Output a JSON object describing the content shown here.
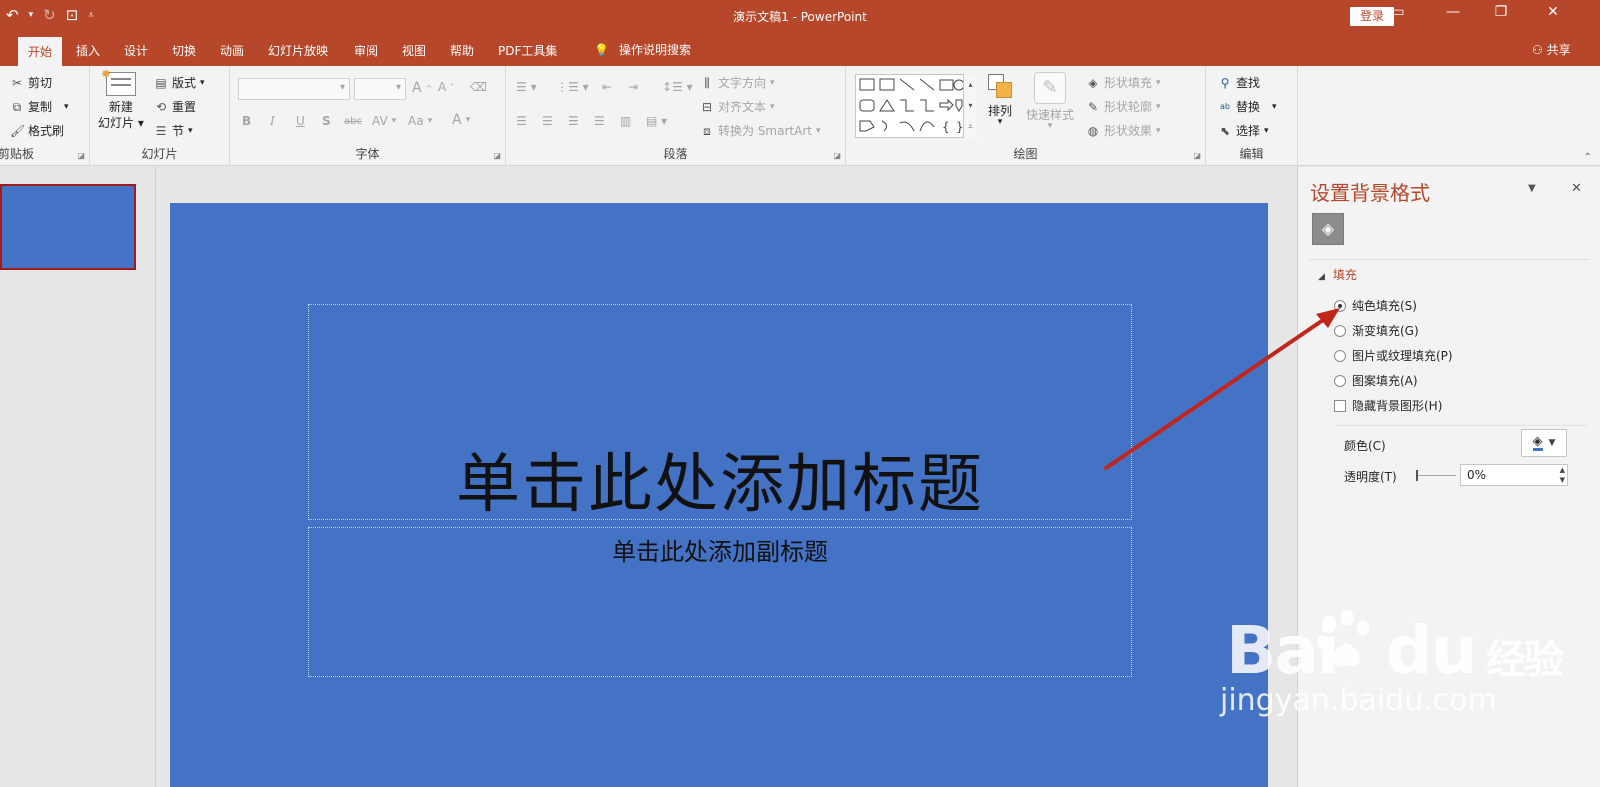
{
  "titlebar": {
    "title": "演示文稿1  -  PowerPoint",
    "login": "登录",
    "qat": [
      "undo-icon",
      "redo-icon",
      "start-presentation-icon",
      "customize-icon"
    ],
    "controls": [
      "restore-ribbon-icon",
      "minimize-icon",
      "maximize-icon",
      "close-icon"
    ]
  },
  "tabs": {
    "items": [
      "开始",
      "插入",
      "设计",
      "切换",
      "动画",
      "幻灯片放映",
      "审阅",
      "视图",
      "帮助",
      "PDF工具集"
    ],
    "active": "开始",
    "tell_me": "操作说明搜索",
    "share": "共享"
  },
  "ribbon": {
    "clipboard": {
      "label": "剪贴板",
      "cut": "剪切",
      "copy": "复制",
      "format_painter": "格式刷"
    },
    "slides": {
      "label": "幻灯片",
      "new_slide_1": "新建",
      "new_slide_2": "幻灯片",
      "layout": "版式",
      "reset": "重置",
      "section": "节"
    },
    "font": {
      "label": "字体",
      "bold": "B",
      "italic": "I",
      "underline": "U",
      "shadow": "S",
      "strike": "abc",
      "spacing": "AV",
      "case": "Aa",
      "color": "A",
      "grow": "A",
      "shrink": "A"
    },
    "paragraph": {
      "label": "段落",
      "text_direction": "文字方向",
      "align_text": "对齐文本",
      "smartart": "转换为 SmartArt"
    },
    "drawing": {
      "label": "绘图",
      "arrange": "排列",
      "quick_styles": "快速样式",
      "shape_fill": "形状填充",
      "shape_outline": "形状轮廓",
      "shape_effects": "形状效果"
    },
    "editing": {
      "label": "编辑",
      "find": "查找",
      "replace": "替换",
      "select": "选择"
    }
  },
  "slide": {
    "title_placeholder": "单击此处添加标题",
    "subtitle_placeholder": "单击此处添加副标题",
    "background_color": "#4472c4"
  },
  "pane": {
    "title": "设置背景格式",
    "section": "填充",
    "options": [
      {
        "label": "纯色填充(S)",
        "checked": true
      },
      {
        "label": "渐变填充(G)",
        "checked": false
      },
      {
        "label": "图片或纹理填充(P)",
        "checked": false
      },
      {
        "label": "图案填充(A)",
        "checked": false
      }
    ],
    "hide_bg": "隐藏背景图形(H)",
    "color_label": "颜色(C)",
    "transparency_label": "透明度(T)",
    "transparency_value": "0%"
  },
  "watermark": {
    "brand": "Bai",
    "brand2": "du",
    "cn": "经验",
    "url": "jingyan.baidu.com"
  },
  "colors": {
    "accent": "#b7472a",
    "slide": "#4472c4",
    "arrow": "#c0261c"
  }
}
